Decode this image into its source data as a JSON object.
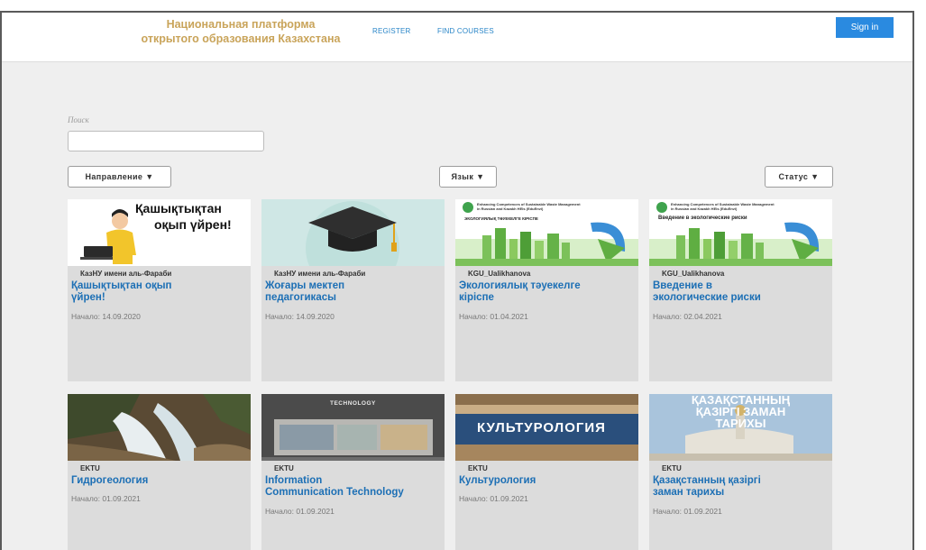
{
  "header": {
    "logo_line1": "Национальная платформа",
    "logo_line2": "открытого образования Казахстана",
    "nav": [
      "REGISTER",
      "FIND COURSES"
    ],
    "signin": "Sign in"
  },
  "search": {
    "label": "Поиск",
    "value": "",
    "placeholder": ""
  },
  "filters": {
    "direction": "Направление ▼",
    "language": "Язык ▼",
    "status": "Статус ▼"
  },
  "cards": [
    {
      "university": "КазНУ имени аль-Фараби",
      "title_lines": [
        "Қашықтықтан оқып",
        "үйрен!"
      ],
      "start": "Начало: 14.09.2020",
      "image_text": [
        "Қашықтықтан",
        "оқып үйрен!"
      ]
    },
    {
      "university": "КазНУ имени аль-Фараби",
      "title_lines": [
        "Жоғары мектеп",
        "педагогикасы"
      ],
      "start": "Начало: 14.09.2020"
    },
    {
      "university": "KGU_Ualikhanova",
      "title_lines": [
        "Экологиялық тәуекелге",
        "кіріспе"
      ],
      "start": "Начало: 01.04.2021",
      "image_text": [
        "Enhancing Competences of Sustainable Waste Management",
        "in Russian and Kazakh HEIs (EduEnvi)",
        "ЭКОЛОГИЯЛЫҚ ТӘУЕКЕЛГЕ КІРІСПЕ"
      ]
    },
    {
      "university": "KGU_Ualikhanova",
      "title_lines": [
        "Введение в",
        "экологические риски"
      ],
      "start": "Начало: 02.04.2021",
      "image_text": [
        "Enhancing Competences of Sustainable Waste Management",
        "in Russian and Kazakh HEIs (EduEnvi)",
        "Введение в экологические риски"
      ]
    },
    {
      "university": "EKTU",
      "title_lines": [
        "Гидрогеология"
      ],
      "start": "Начало: 01.09.2021"
    },
    {
      "university": "EKTU",
      "title_lines": [
        "Information",
        "Communication Technology"
      ],
      "start": "Начало: 01.09.2021",
      "image_text": [
        "TECHNOLOGY"
      ]
    },
    {
      "university": "EKTU",
      "title_lines": [
        "Культурология"
      ],
      "start": "Начало: 01.09.2021",
      "image_text": [
        "КУЛЬТУРОЛОГИЯ"
      ]
    },
    {
      "university": "EKTU",
      "title_lines": [
        "Қазақстанның қазіргі",
        "заман тарихы"
      ],
      "start": "Начало: 01.09.2021",
      "image_text": [
        "ҚАЗАҚСТАННЫҢ",
        "ҚАЗІРГІ ЗАМАН",
        "ТАРИХЫ"
      ]
    }
  ],
  "colors": {
    "accent": "#2a8ae0",
    "link": "#1c6fb5",
    "logo": "#c9a45a",
    "card_bg": "#dcdcdc",
    "page_bg": "#efefef"
  },
  "icons": [
    "graduation-cap-icon",
    "eco-logo-icon",
    "dropdown-caret-icon"
  ]
}
